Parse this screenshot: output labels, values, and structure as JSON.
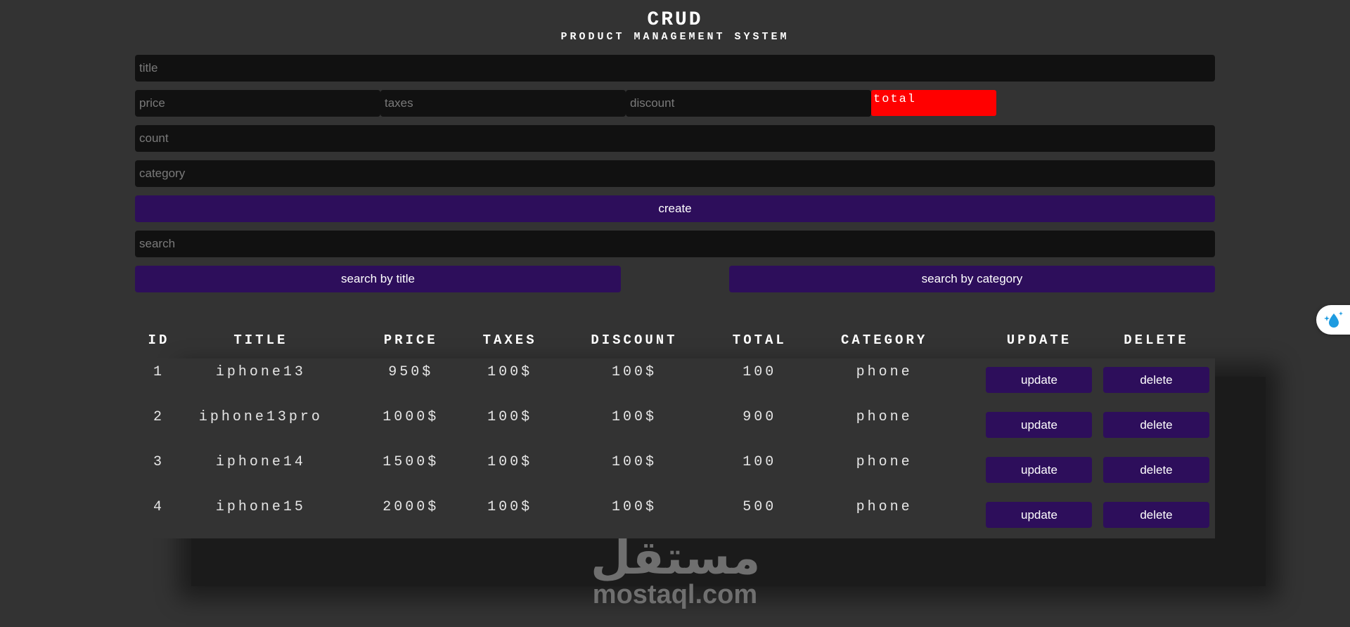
{
  "header": {
    "title": "CRUD",
    "subtitle": "PRODUCT MANAGEMENT SYSTEM"
  },
  "form": {
    "title_placeholder": "title",
    "price_placeholder": "price",
    "taxes_placeholder": "taxes",
    "discount_placeholder": "discount",
    "total_label": "total",
    "total_color": "#ff0000",
    "count_placeholder": "count",
    "category_placeholder": "category",
    "create_label": "create",
    "accent_color": "#2d0e5b"
  },
  "search": {
    "placeholder": "search",
    "by_title_label": "search by title",
    "by_category_label": "search by category"
  },
  "table": {
    "headers": [
      "ID",
      "TITLE",
      "PRICE",
      "TAXES",
      "DISCOUNT",
      "TOTAL",
      "CATEGORY",
      "UPDATE",
      "DELETE"
    ],
    "rows": [
      {
        "id": "1",
        "title": "iphone13",
        "price": "950$",
        "taxes": "100$",
        "discount": "100$",
        "total": "100",
        "category": "phone",
        "update": "update",
        "delete": "delete"
      },
      {
        "id": "2",
        "title": "iphone13pro",
        "price": "1000$",
        "taxes": "100$",
        "discount": "100$",
        "total": "900",
        "category": "phone",
        "update": "update",
        "delete": "delete"
      },
      {
        "id": "3",
        "title": "iphone14",
        "price": "1500$",
        "taxes": "100$",
        "discount": "100$",
        "total": "100",
        "category": "phone",
        "update": "update",
        "delete": "delete"
      },
      {
        "id": "4",
        "title": "iphone15",
        "price": "2000$",
        "taxes": "100$",
        "discount": "100$",
        "total": "500",
        "category": "phone",
        "update": "update",
        "delete": "delete"
      }
    ]
  },
  "watermark": {
    "arabic": "مستقل",
    "domain": "mostaql.com"
  },
  "widget": {
    "icon": "sparkle-drop-icon"
  }
}
